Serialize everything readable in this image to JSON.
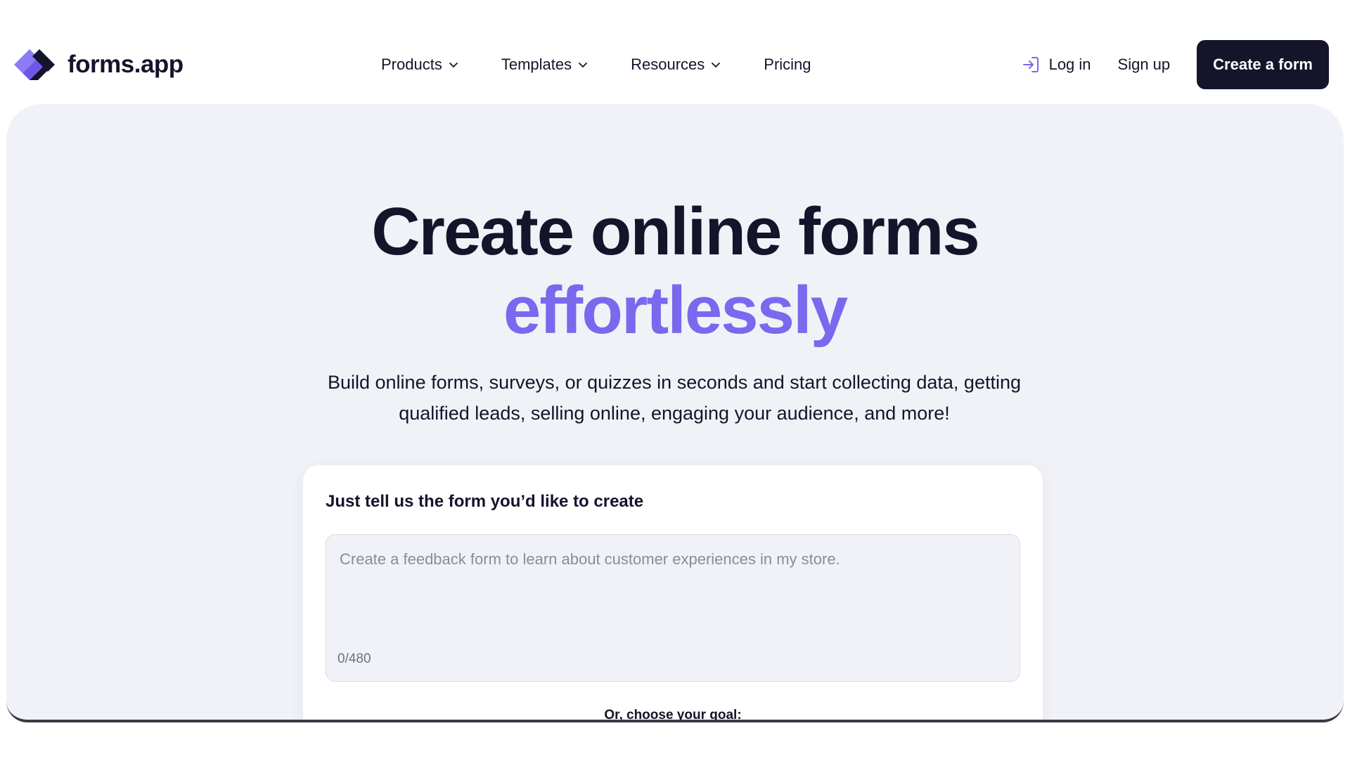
{
  "header": {
    "logo_text": "forms.app",
    "nav": [
      {
        "label": "Products",
        "has_dropdown": true
      },
      {
        "label": "Templates",
        "has_dropdown": true
      },
      {
        "label": "Resources",
        "has_dropdown": true
      },
      {
        "label": "Pricing",
        "has_dropdown": false
      }
    ],
    "login_label": "Log in",
    "signup_label": "Sign up",
    "cta_label": "Create a form"
  },
  "hero": {
    "title": "Create online forms",
    "title_accent": "effortlessly",
    "subtitle": "Build online forms, surveys, or quizzes in seconds and start collecting data, getting qualified leads, selling online, engaging your audience, and more!"
  },
  "ai_card": {
    "title": "Just tell us the form you’d like to create",
    "input_value": "",
    "input_placeholder": "Create a feedback form to learn about customer experiences in my store.",
    "char_counter": "0/480",
    "goal_label": "Or, choose your goal:"
  },
  "colors": {
    "brand_dark": "#14142b",
    "accent_purple": "#7b68ee",
    "hero_background": "#f1f2f7"
  },
  "icons": {
    "logo": "forms-app-logo-icon",
    "dropdown": "chevron-down-icon",
    "login": "login-arrow-icon"
  }
}
